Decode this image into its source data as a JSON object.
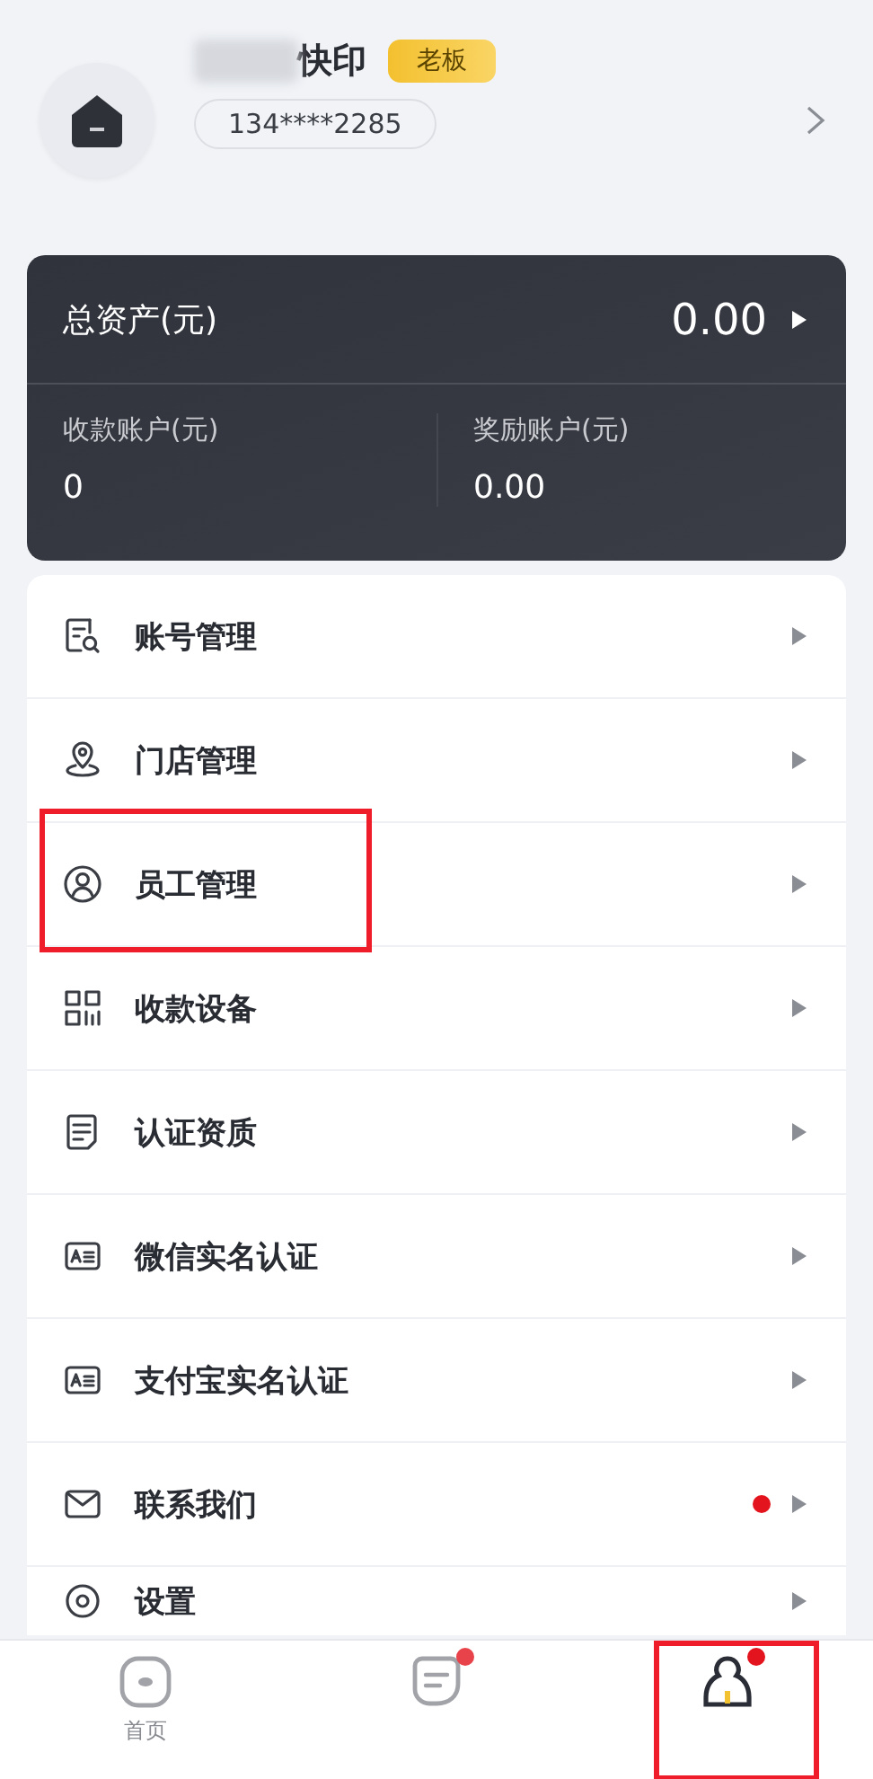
{
  "profile": {
    "name": "快印",
    "role": "老板",
    "phone": "134****2285"
  },
  "assets": {
    "total_label": "总资产(元)",
    "total_value": "0.00",
    "accounts": [
      {
        "label": "收款账户(元)",
        "value": "0"
      },
      {
        "label": "奖励账户(元)",
        "value": "0.00"
      }
    ]
  },
  "menu": [
    {
      "label": "账号管理",
      "kind": "doc-search",
      "dot": false,
      "highlighted": false
    },
    {
      "label": "门店管理",
      "kind": "pin",
      "dot": false,
      "highlighted": false
    },
    {
      "label": "员工管理",
      "kind": "person",
      "dot": false,
      "highlighted": true
    },
    {
      "label": "收款设备",
      "kind": "grid",
      "dot": false,
      "highlighted": false
    },
    {
      "label": "认证资质",
      "kind": "doc",
      "dot": false,
      "highlighted": false
    },
    {
      "label": "微信实名认证",
      "kind": "card",
      "dot": false,
      "highlighted": false
    },
    {
      "label": "支付宝实名认证",
      "kind": "card",
      "dot": false,
      "highlighted": false
    },
    {
      "label": "联系我们",
      "kind": "mail",
      "dot": true,
      "highlighted": false
    },
    {
      "label": "设置",
      "kind": "gear",
      "dot": false,
      "highlighted": false
    }
  ],
  "tab_bar": [
    {
      "label": "首页",
      "kind": "home",
      "selected": false,
      "dot": false,
      "highlighted": false
    },
    {
      "kind": "message",
      "selected": false,
      "dot": true,
      "highlighted": false
    },
    {
      "kind": "user",
      "selected": true,
      "dot": true,
      "highlighted": true
    }
  ]
}
